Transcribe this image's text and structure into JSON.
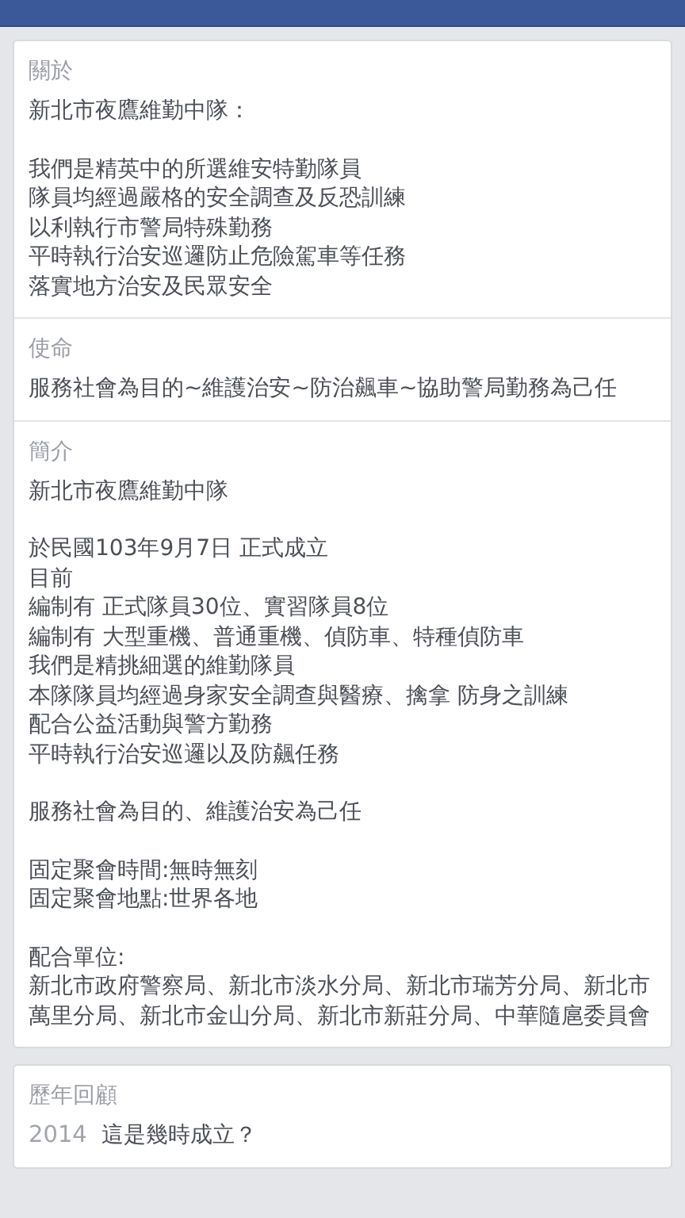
{
  "sections": [
    {
      "label": "關於",
      "paragraphs": [
        [
          "新北市夜鷹維勤中隊："
        ],
        [
          "我們是精英中的所選維安特勤隊員",
          "隊員均經過嚴格的安全調查及反恐訓練",
          "以利執行市警局特殊勤務",
          "平時執行治安巡邏防止危險駕車等任務",
          "落實地方治安及民眾安全"
        ]
      ]
    },
    {
      "label": "使命",
      "paragraphs": [
        [
          "服務社會為目的~維護治安~防治飆車~協助警局勤務為己任"
        ]
      ]
    },
    {
      "label": "簡介",
      "paragraphs": [
        [
          "新北市夜鷹維勤中隊"
        ],
        [
          "於民國103年9月7日 正式成立",
          "目前",
          "編制有 正式隊員30位、實習隊員8位",
          "編制有 大型重機、普通重機、偵防車、特種偵防車",
          "我們是精挑細選的維勤隊員",
          "本隊隊員均經過身家安全調查與醫療、擒拿 防身之訓練",
          "配合公益活動與警方勤務",
          "平時執行治安巡邏以及防飆任務"
        ],
        [
          "服務社會為目的、維護治安為己任"
        ],
        [
          "固定聚會時間:無時無刻",
          "固定聚會地點:世界各地"
        ],
        [
          "配合單位:",
          "新北市政府警察局、新北市淡水分局、新北市瑞芳分局、新北市萬里分局、新北市金山分局、新北市新莊分局、中華隨扈委員會"
        ]
      ]
    }
  ],
  "history": {
    "label": "歷年回顧",
    "items": [
      {
        "year": "2014",
        "text": "這是幾時成立？"
      }
    ]
  }
}
